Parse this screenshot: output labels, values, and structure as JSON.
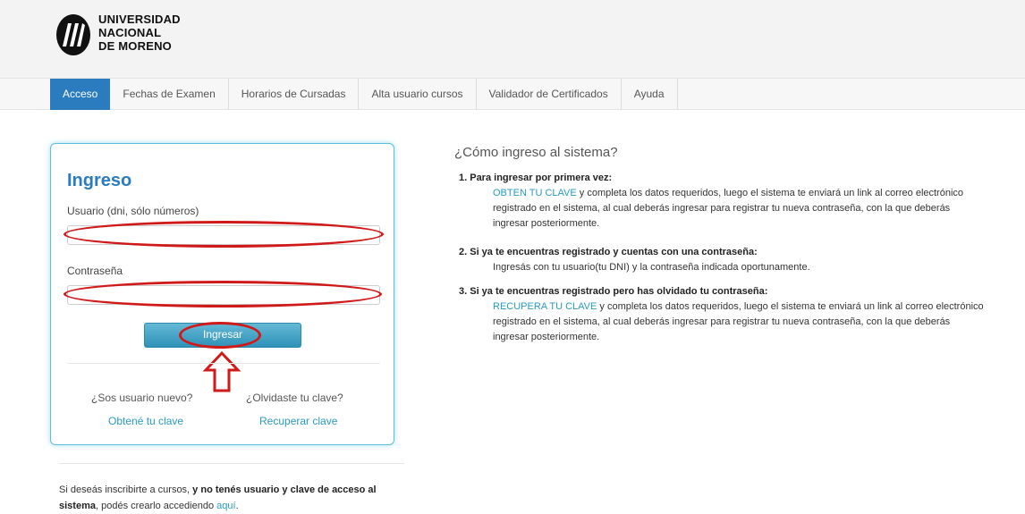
{
  "brand": {
    "line1": "UNIVERSIDAD",
    "line2": "NACIONAL",
    "line3": "DE MORENO",
    "logo_icon": "unm-logo-icon"
  },
  "nav": {
    "items": [
      {
        "label": "Acceso",
        "active": true
      },
      {
        "label": "Fechas de Examen"
      },
      {
        "label": "Horarios de Cursadas"
      },
      {
        "label": "Alta usuario cursos"
      },
      {
        "label": "Validador de Certificados"
      },
      {
        "label": "Ayuda"
      }
    ]
  },
  "login": {
    "title": "Ingreso",
    "user_label": "Usuario (dni, sólo números)",
    "user_value": "",
    "password_label": "Contraseña",
    "password_value": "",
    "submit_label": "Ingresar",
    "new_user_question": "¿Sos usuario nuevo?",
    "new_user_link": "Obtené tu clave",
    "forgot_question": "¿Olvidaste tu clave?",
    "forgot_link": "Recuperar clave"
  },
  "signup_note": {
    "part1": "Si deseás inscribirte a cursos, ",
    "bold": "y no tenés usuario y clave de acceso al sistema",
    "part2": ", podés crearlo accediendo ",
    "link": "aquí",
    "end": "."
  },
  "how": {
    "title": "¿Cómo ingreso al sistema?",
    "step1": {
      "head": "1. Para ingresar por primera vez:",
      "link": "OBTEN TU CLAVE",
      "text": " y completa los datos requeridos, luego el sistema te enviará un link al correo electrónico registrado en el sistema, al cual deberás ingresar para registrar tu nueva contraseña, con la que deberás ingresar posteriormente."
    },
    "step2": {
      "head": "2. Si ya te encuentras registrado y cuentas con una contraseña:",
      "text": "Ingresás con tu usuario(tu DNI) y la contraseña indicada oportunamente."
    },
    "step3": {
      "head": "3. Si ya te encuentras registrado pero has olvidado tu contraseña:",
      "link": "RECUPERA TU CLAVE",
      "text": " y completa los datos requeridos, luego el sistema te enviará un link al correo electrónico registrado en el sistema, al cual deberás ingresar para registrar tu nueva contraseña, con la que deberás ingresar posteriormente."
    }
  },
  "colors": {
    "accent": "#2a7cbf",
    "link": "#2a9bc0",
    "card_border": "#5bc0de",
    "annotation": "#d01a1a"
  }
}
